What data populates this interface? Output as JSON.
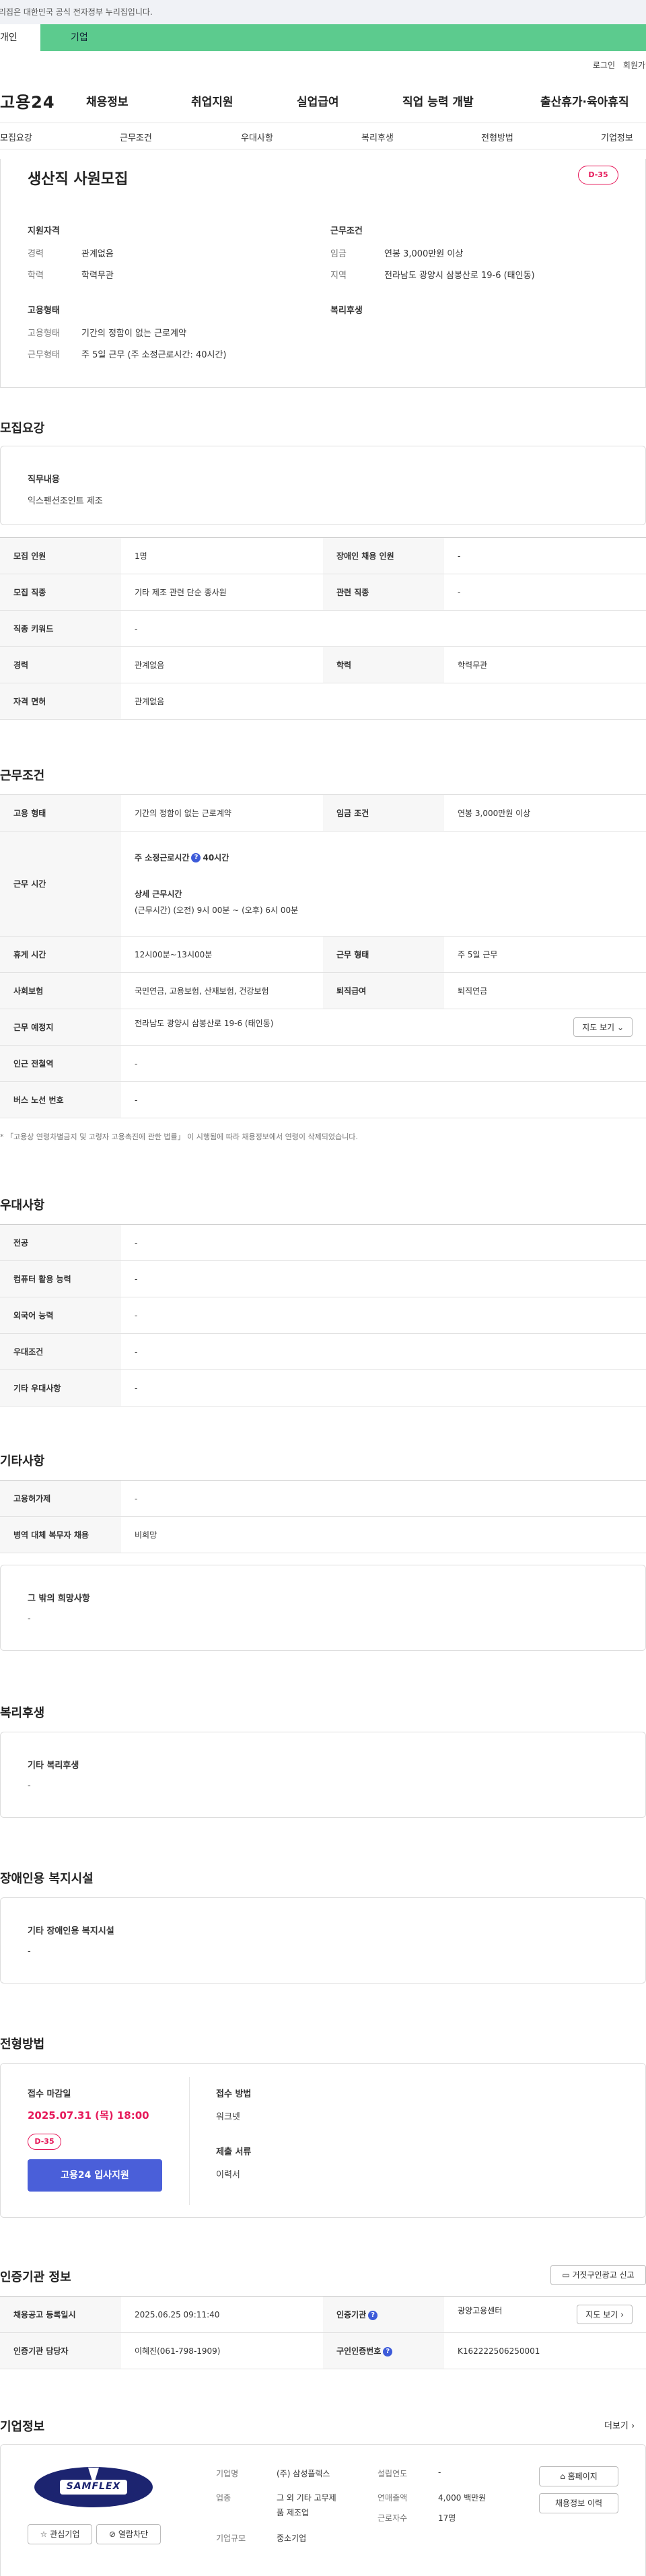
{
  "gov_banner": "이 누리집은 대한민국 공식 전자정부 누리집입니다.",
  "tabs": {
    "personal": "개인",
    "company": "기업"
  },
  "util": {
    "login": "로그인",
    "join": "회원가입"
  },
  "site": {
    "logo": "고용24"
  },
  "gnb": [
    "채용정보",
    "취업지원",
    "실업급여",
    "직업 능력 개발",
    "출산휴가·육아휴직"
  ],
  "anchors": [
    "모집요강",
    "근무조건",
    "우대사항",
    "복리후생",
    "전형방법",
    "기업정보"
  ],
  "summary": {
    "title": "생산직 사원모집",
    "dday": "D-35",
    "qual_header": "지원자격",
    "career_k": "경력",
    "career_v": "관계없음",
    "edu_k": "학력",
    "edu_v": "학력무관",
    "emp_header": "고용형태",
    "emptype_k": "고용형태",
    "emptype_v": "기간의 정함이 없는 근로계약",
    "worktype_k": "근무형태",
    "worktype_v": "주 5일 근무 (주 소정근로시간: 40시간)",
    "cond_header": "근무조건",
    "wage_k": "임금",
    "wage_v": "연봉 3,000만원 이상",
    "region_k": "지역",
    "region_v": "전라남도 광양시 삼봉산로 19-6 (태인동)",
    "welfare_header": "복리후생"
  },
  "recruit": {
    "title": "모집요강",
    "duty_h": "직무내용",
    "duty_v": "익스펜션조인트 제조",
    "rows": [
      {
        "k1": "모집 인원",
        "v1": "1명",
        "k2": "장애인 채용 인원",
        "v2": "-"
      },
      {
        "k1": "모집 직종",
        "v1": "기타 제조 관련 단순 종사원",
        "k2": "관련 직종",
        "v2": "-"
      },
      {
        "k1": "직종 키워드",
        "v1": "-"
      },
      {
        "k1": "경력",
        "v1": "관계없음",
        "k2": "학력",
        "v2": "학력무관"
      },
      {
        "k1": "자격 면허",
        "v1": "관계없음"
      }
    ]
  },
  "work": {
    "title": "근무조건",
    "emptype_k": "고용 형태",
    "emptype_v": "기간의 정함이 없는 근로계약",
    "wagecond_k": "임금 조건",
    "wagecond_v": "연봉 3,000만원 이상",
    "hours_k": "근무 시간",
    "hours_weekly_label": "주 소정근로시간",
    "hours_weekly_value": "40시간",
    "hours_detail_label": "상세 근무시간",
    "hours_detail_value": "(근무시간) (오전) 9시 00분 ~ (오후) 6시 00분",
    "break_k": "휴게 시간",
    "break_v": "12시00분~13시00분",
    "worktype_k": "근무 형태",
    "worktype_v": "주 5일 근무",
    "insurance_k": "사회보험",
    "insurance_v": "국민연금, 고용보험, 산재보험, 건강보험",
    "retire_k": "퇴직급여",
    "retire_v": "퇴직연금",
    "place_k": "근무 예정지",
    "place_v": "전라남도 광양시 삼봉산로 19-6 (태인동)",
    "map_btn": "지도 보기",
    "subway_k": "인근 전철역",
    "subway_v": "-",
    "bus_k": "버스 노선 번호",
    "bus_v": "-",
    "note": "* 「고용상 연령차별금지 및 고령자 고용촉진에 관한 법률」 이 시행됨에 따라 채용정보에서 연령이 삭제되었습니다."
  },
  "pref": {
    "title": "우대사항",
    "rows": [
      {
        "k": "전공",
        "v": "-"
      },
      {
        "k": "컴퓨터 활용 능력",
        "v": "-"
      },
      {
        "k": "외국어 능력",
        "v": "-"
      },
      {
        "k": "우대조건",
        "v": "-"
      },
      {
        "k": "기타 우대사항",
        "v": "-"
      }
    ]
  },
  "etc": {
    "title": "기타사항",
    "rows": [
      {
        "k": "고용허가제",
        "v": "-"
      },
      {
        "k": "병역 대체 복무자 채용",
        "v": "비희망"
      }
    ],
    "other_h": "그 밖의 희망사항",
    "other_v": "-"
  },
  "welfare": {
    "title": "복리후생",
    "h": "기타 복리후생",
    "v": "-"
  },
  "disability": {
    "title": "장애인용 복지시설",
    "h": "기타 장애인용 복지시설",
    "v": "-"
  },
  "selection": {
    "title": "전형방법",
    "deadline_h": "접수 마감일",
    "deadline_v": "2025.07.31 (목) 18:00",
    "dday": "D-35",
    "apply_btn": "고용24 입사지원",
    "method_h": "접수 방법",
    "method_v": "워크넷",
    "docs_h": "제출 서류",
    "docs_v": "이력서"
  },
  "agency": {
    "title": "인증기관 정보",
    "report_btn": "거짓구인광고 신고",
    "reg_k": "채용공고 등록일시",
    "reg_v": "2025.06.25 09:11:40",
    "org_k": "인증기관",
    "org_v": "광양고용센터",
    "map_btn": "지도 보기",
    "manager_k": "인증기관 담당자",
    "manager_v": "이혜진(061-798-1909)",
    "jobno_k": "구인인증번호",
    "jobno_v": "K162222506250001"
  },
  "company": {
    "title": "기업정보",
    "more": "더보기",
    "logo_text": "SAMFLEX",
    "fav_btn": "관심기업",
    "block_btn": "열람차단",
    "name_k": "기업명",
    "name_v": "(주) 삼성플렉스",
    "industry_k": "업종",
    "industry_v1": "그 외 기타 고무제",
    "industry_v2": "품 제조업",
    "size_k": "기업규모",
    "size_v": "중소기업",
    "founded_k": "설립연도",
    "founded_v": "-",
    "sales_k": "연매출액",
    "sales_v": "4,000 백만원",
    "employees_k": "근로자수",
    "employees_v": "17명",
    "homepage_btn": "홈페이지",
    "history_btn": "채용정보 이력"
  },
  "colors": {
    "accent": "#4a5fd9",
    "dday": "#e6195a",
    "tab_green": "#5ccb8e"
  }
}
